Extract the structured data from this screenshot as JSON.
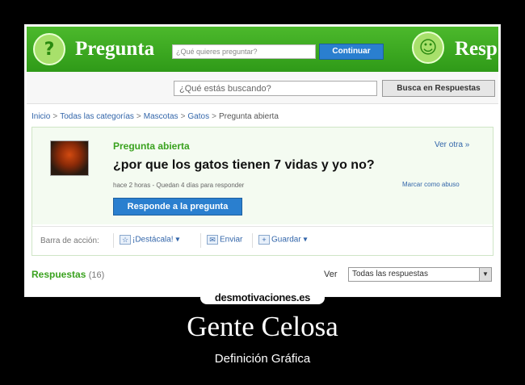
{
  "banner": {
    "brand_left": "Pregunta",
    "brand_right": "Resp",
    "ask_placeholder": "¿Qué quieres preguntar?",
    "continue_label": "Continuar"
  },
  "search": {
    "placeholder": "¿Qué estás buscando?",
    "button_label": "Busca en Respuestas"
  },
  "breadcrumb": {
    "items": [
      "Inicio",
      "Todas las categorías",
      "Mascotas",
      "Gatos"
    ],
    "current": "Pregunta abierta",
    "separator": ">"
  },
  "question": {
    "status": "Pregunta abierta",
    "see_other": "Ver otra »",
    "title": "¿por que los gatos tienen 7 vidas y yo no?",
    "meta": "hace 2 horas - Quedan 4 días para responder",
    "flag": "Marcar como abuso",
    "answer_button": "Responde a la pregunta"
  },
  "actionbar": {
    "label": "Barra de acción:",
    "star": "¡Destácala!",
    "email": "Enviar",
    "save": "Guardar"
  },
  "answers": {
    "label": "Respuestas",
    "count": "(16)",
    "view_label": "Ver",
    "view_selected": "Todas las respuestas"
  },
  "watermark": "desmotivaciones.es",
  "caption": {
    "title": "Gente Celosa",
    "subtitle": "Definición Gráfica"
  },
  "colors": {
    "brand_green": "#3aa21f",
    "link_blue": "#3366aa",
    "button_blue": "#2a7fcf"
  }
}
